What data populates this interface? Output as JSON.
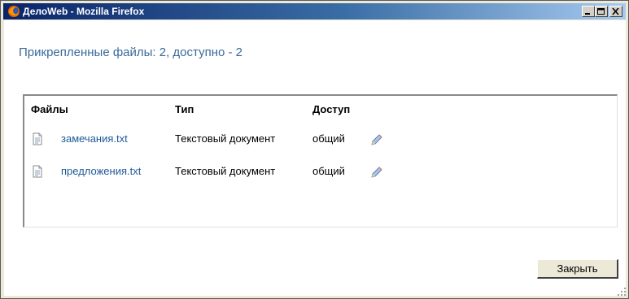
{
  "window": {
    "title": "ДелоWeb - Mozilla Firefox",
    "controls": [
      "minimize-icon",
      "maximize-icon",
      "close-icon"
    ]
  },
  "heading": "Прикрепленные файлы: 2, доступно - 2",
  "table": {
    "columns": [
      "Файлы",
      "Тип",
      "Доступ"
    ],
    "rows": [
      {
        "name": "замечания.txt",
        "type": "Текстовый документ",
        "access": "общий"
      },
      {
        "name": "предложения.txt",
        "type": "Текстовый документ",
        "access": "общий"
      }
    ]
  },
  "buttons": {
    "close_label": "Закрыть"
  },
  "colors": {
    "titlebar_start": "#0a246a",
    "titlebar_end": "#a6caf0",
    "link": "#1e5a96",
    "heading": "#3a6a9a"
  }
}
